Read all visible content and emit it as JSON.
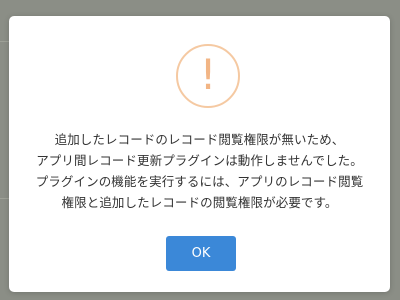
{
  "dialog": {
    "icon": "exclamation-warning-icon",
    "icon_glyph": "!",
    "icon_color": "#f2b585",
    "message_lines": [
      "追加したレコードのレコード閲覧権限が無いため、",
      "アプリ間レコード更新プラグインは動作しませんでした。",
      "プラグインの機能を実行するには、アプリのレコード閲覧",
      "権限と追加したレコードの閲覧権限が必要です。"
    ],
    "ok_label": "OK",
    "ok_color": "#3b88d8"
  }
}
